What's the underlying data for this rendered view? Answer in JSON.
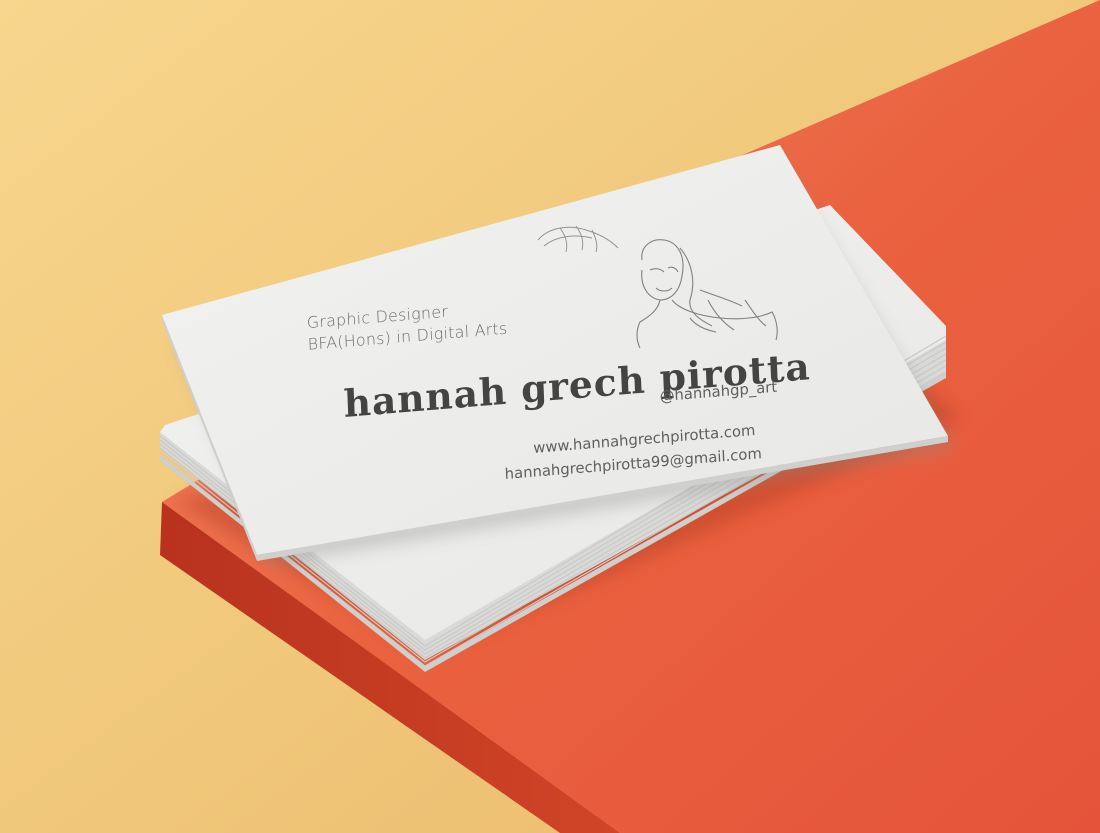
{
  "card": {
    "role": "Graphic Designer",
    "degree": "BFA(Hons) in Digital Arts",
    "name": "hannah grech pirotta",
    "instagram": "@hannahgp_art",
    "website": "www.hannahgrechpirotta.com",
    "email": "hannahgrechpirotta99@gmail.com"
  },
  "colors": {
    "background_yellow": "#f2cd7f",
    "table_red": "#e8583a",
    "card_white": "#efefed",
    "text_gray": "#5f5f5f"
  },
  "icons": [
    "leaf-sketch-icon",
    "portrait-line-drawing-icon"
  ]
}
